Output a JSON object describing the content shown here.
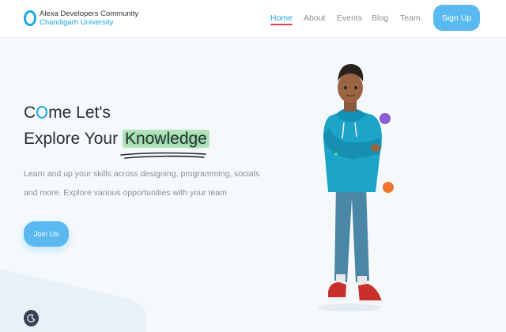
{
  "brand": {
    "line1": "Alexa Developers Community",
    "line2": "Chandigarh University"
  },
  "nav": {
    "items": [
      {
        "label": "Home"
      },
      {
        "label": "About"
      },
      {
        "label": "Events"
      },
      {
        "label": "Blog"
      },
      {
        "label": "Team"
      }
    ],
    "signup": "Sign Up"
  },
  "hero": {
    "title_line1_pre": "C",
    "title_line1_post": "me Let's",
    "title_line2_pre": "Explore Your",
    "title_highlight": "Knowledge",
    "para_line1": "Learn and up your skills across designing, programming, socials",
    "para_line2": "and more. Explore various opportunities with your team",
    "join": "Join Us"
  },
  "colors": {
    "accent": "#1ea8e0",
    "button": "#5ab9f0",
    "active_underline": "#e0444b",
    "highlight": "#b8e4c0"
  },
  "icons": {
    "theme_toggle": "moon-icon",
    "brand": "alexa-ring-icon"
  }
}
